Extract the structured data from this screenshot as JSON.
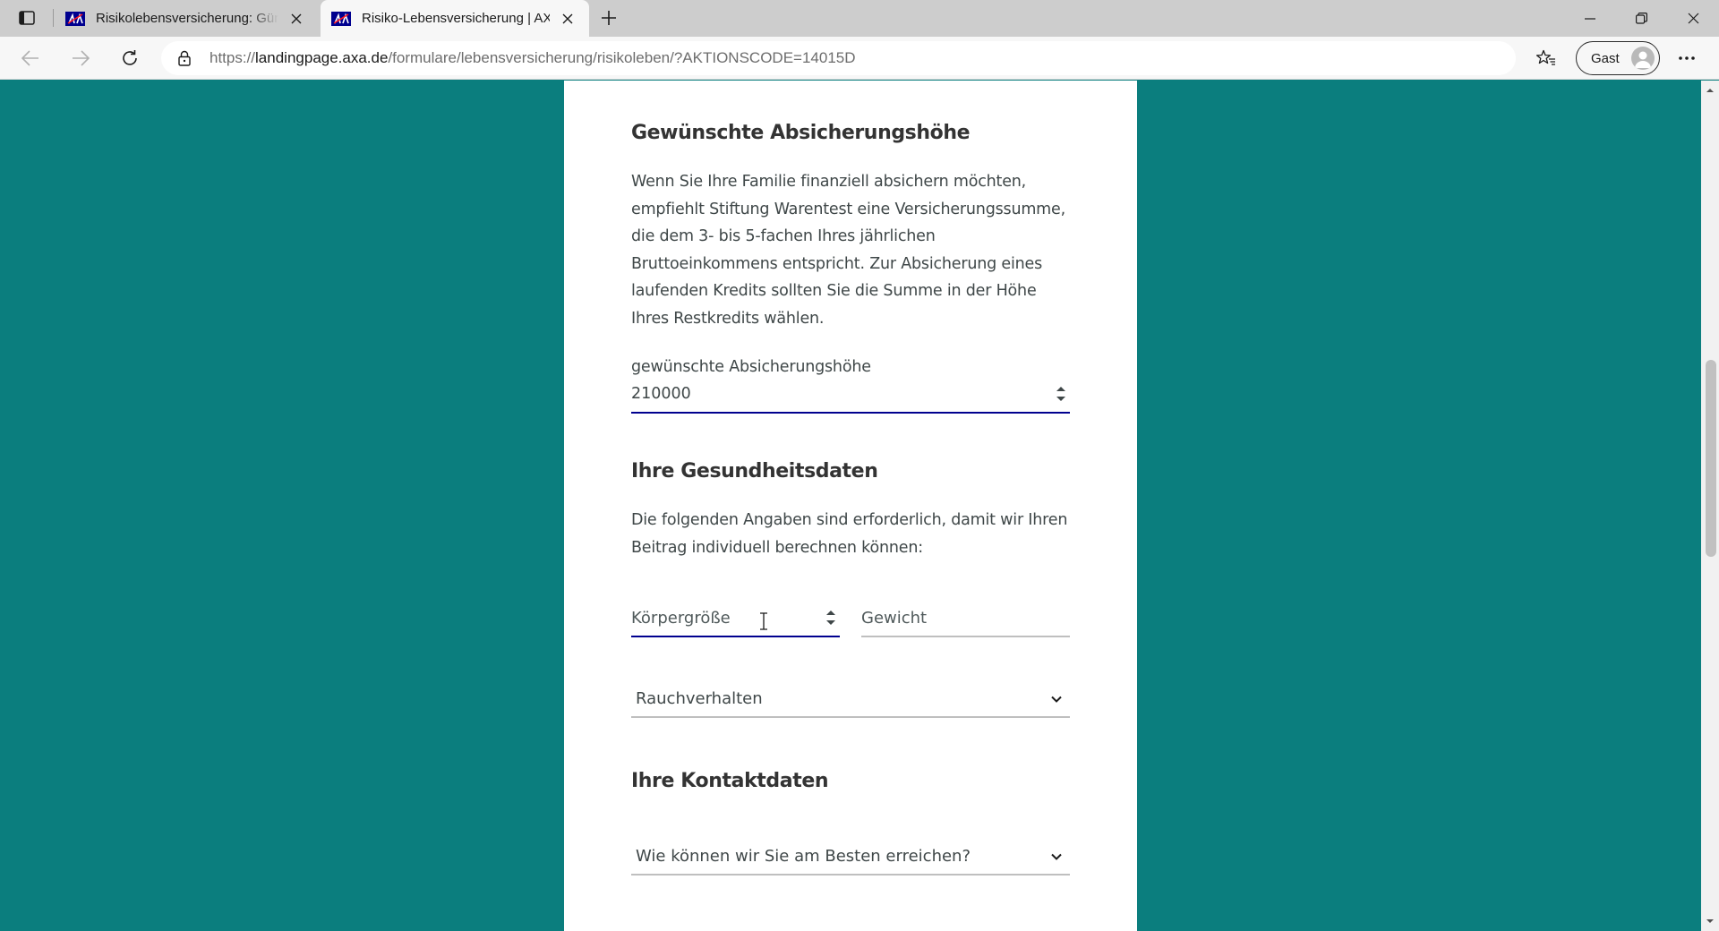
{
  "browser": {
    "tabs": [
      {
        "title": "Risikolebensversicherung: Günstig",
        "active": false
      },
      {
        "title": "Risiko-Lebensversicherung | AXA",
        "active": true
      }
    ],
    "address": {
      "prefix": "https://",
      "domain": "landingpage.axa.de",
      "path": "/formulare/lebensversicherung/risikoleben/?AKTIONSCODE=14015D"
    },
    "profile_label": "Gast"
  },
  "form": {
    "coverage": {
      "heading": "Gewünschte Absicherungshöhe",
      "description": "Wenn Sie Ihre Familie finanziell absichern möchten, empfiehlt Stiftung Warentest eine Versicherungssumme, die dem 3- bis 5-fachen Ihres jährlichen Bruttoeinkommens entspricht. Zur Absicherung eines laufenden Kredits sollten Sie die Summe in der Höhe Ihres Restkredits wählen.",
      "field_label": "gewünschte Absicherungshöhe",
      "field_value": "210000"
    },
    "health": {
      "heading": "Ihre Gesundheitsdaten",
      "description": "Die folgenden Angaben sind erforderlich, damit wir Ihren Beitrag individuell berechnen können:",
      "height_placeholder": "Körpergröße",
      "weight_placeholder": "Gewicht",
      "smoking_select": "Rauchverhalten"
    },
    "contact": {
      "heading": "Ihre Kontaktdaten",
      "reach_select": "Wie können wir Sie am Besten erreichen?"
    }
  },
  "colors": {
    "page_background": "#0b7e7e",
    "active_field_underline": "#00008f",
    "axa_blue": "#00008f"
  }
}
